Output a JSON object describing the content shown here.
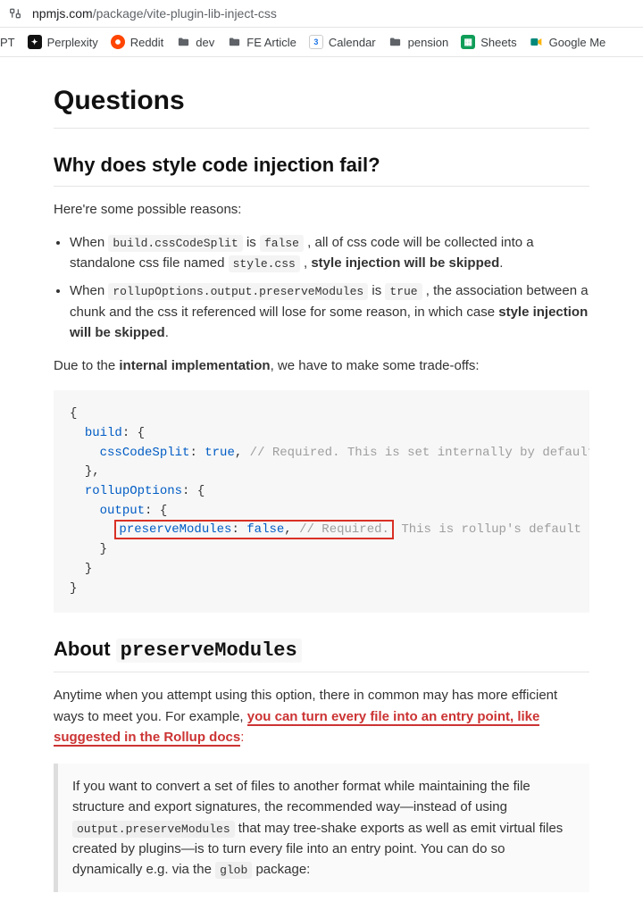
{
  "urlbar": {
    "domain": "npmjs.com",
    "path": "/package/vite-plugin-lib-inject-css"
  },
  "bookmarks": {
    "b0": "PT",
    "b1": "Perplexity",
    "b2": "Reddit",
    "b3": "dev",
    "b4": "FE Article",
    "b5": "Calendar",
    "b5_badge": "3",
    "b6": "pension",
    "b7": "Sheets",
    "b8": "Google Me"
  },
  "doc": {
    "h1": "Questions",
    "h2a": "Why does style code injection fail?",
    "p1": "Here're some possible reasons:",
    "li1_pre": "When ",
    "li1_code1": "build.cssCodeSplit",
    "li1_mid1": " is ",
    "li1_code2": "false",
    "li1_mid2": " , all of css code will be collected into a standalone css file named ",
    "li1_code3": "style.css",
    "li1_mid3": " , ",
    "li1_bold": "style injection will be skipped",
    "li1_end": ".",
    "li2_pre": "When ",
    "li2_code1": "rollupOptions.output.preserveModules",
    "li2_mid1": " is ",
    "li2_code2": "true",
    "li2_mid2": " , the association between a chunk and the css it referenced will lose for some reason, in which case ",
    "li2_bold": "style injection will be skipped",
    "li2_end": ".",
    "p2_pre": "Due to the ",
    "p2_bold": "internal implementation",
    "p2_post": ", we have to make some trade-offs:",
    "code": {
      "l1": "{",
      "l2_k": "build",
      "l2_r": ": {",
      "l3_k": "cssCodeSplit",
      "l3_m": ": ",
      "l3_v": "true",
      "l3_p": ", ",
      "l3_c": "// Required. This is set internally by default.",
      "l4": "},",
      "l5_k": "rollupOptions",
      "l5_r": ": {",
      "l6_k": "output",
      "l6_r": ": {",
      "l7_k": "preserveModules",
      "l7_m": ": ",
      "l7_v": "false",
      "l7_p": ", ",
      "l7_c": "// Required.",
      "l7_c2": " This is rollup's default behavi",
      "l8": "}",
      "l9": "}",
      "l10": "}"
    },
    "h2b_pre": "About ",
    "h2b_code": "preserveModules",
    "p3_a": "Anytime when you attempt using this option, there in common may has more efficient ways to meet you. For example, ",
    "p3_link": "you can turn every file into an entry point, like suggested in the Rollup docs",
    "p3_b": ":",
    "bq_a": "If you want to convert a set of files to another format while maintaining the file structure and export signatures, the recommended way—instead of using ",
    "bq_code1": "output.preserveModules",
    "bq_b": " that may tree-shake exports as well as emit virtual files created by plugins—is to turn every file into an entry point. You can do so dynamically e.g. via the ",
    "bq_code2": "glob",
    "bq_c": " package:"
  }
}
